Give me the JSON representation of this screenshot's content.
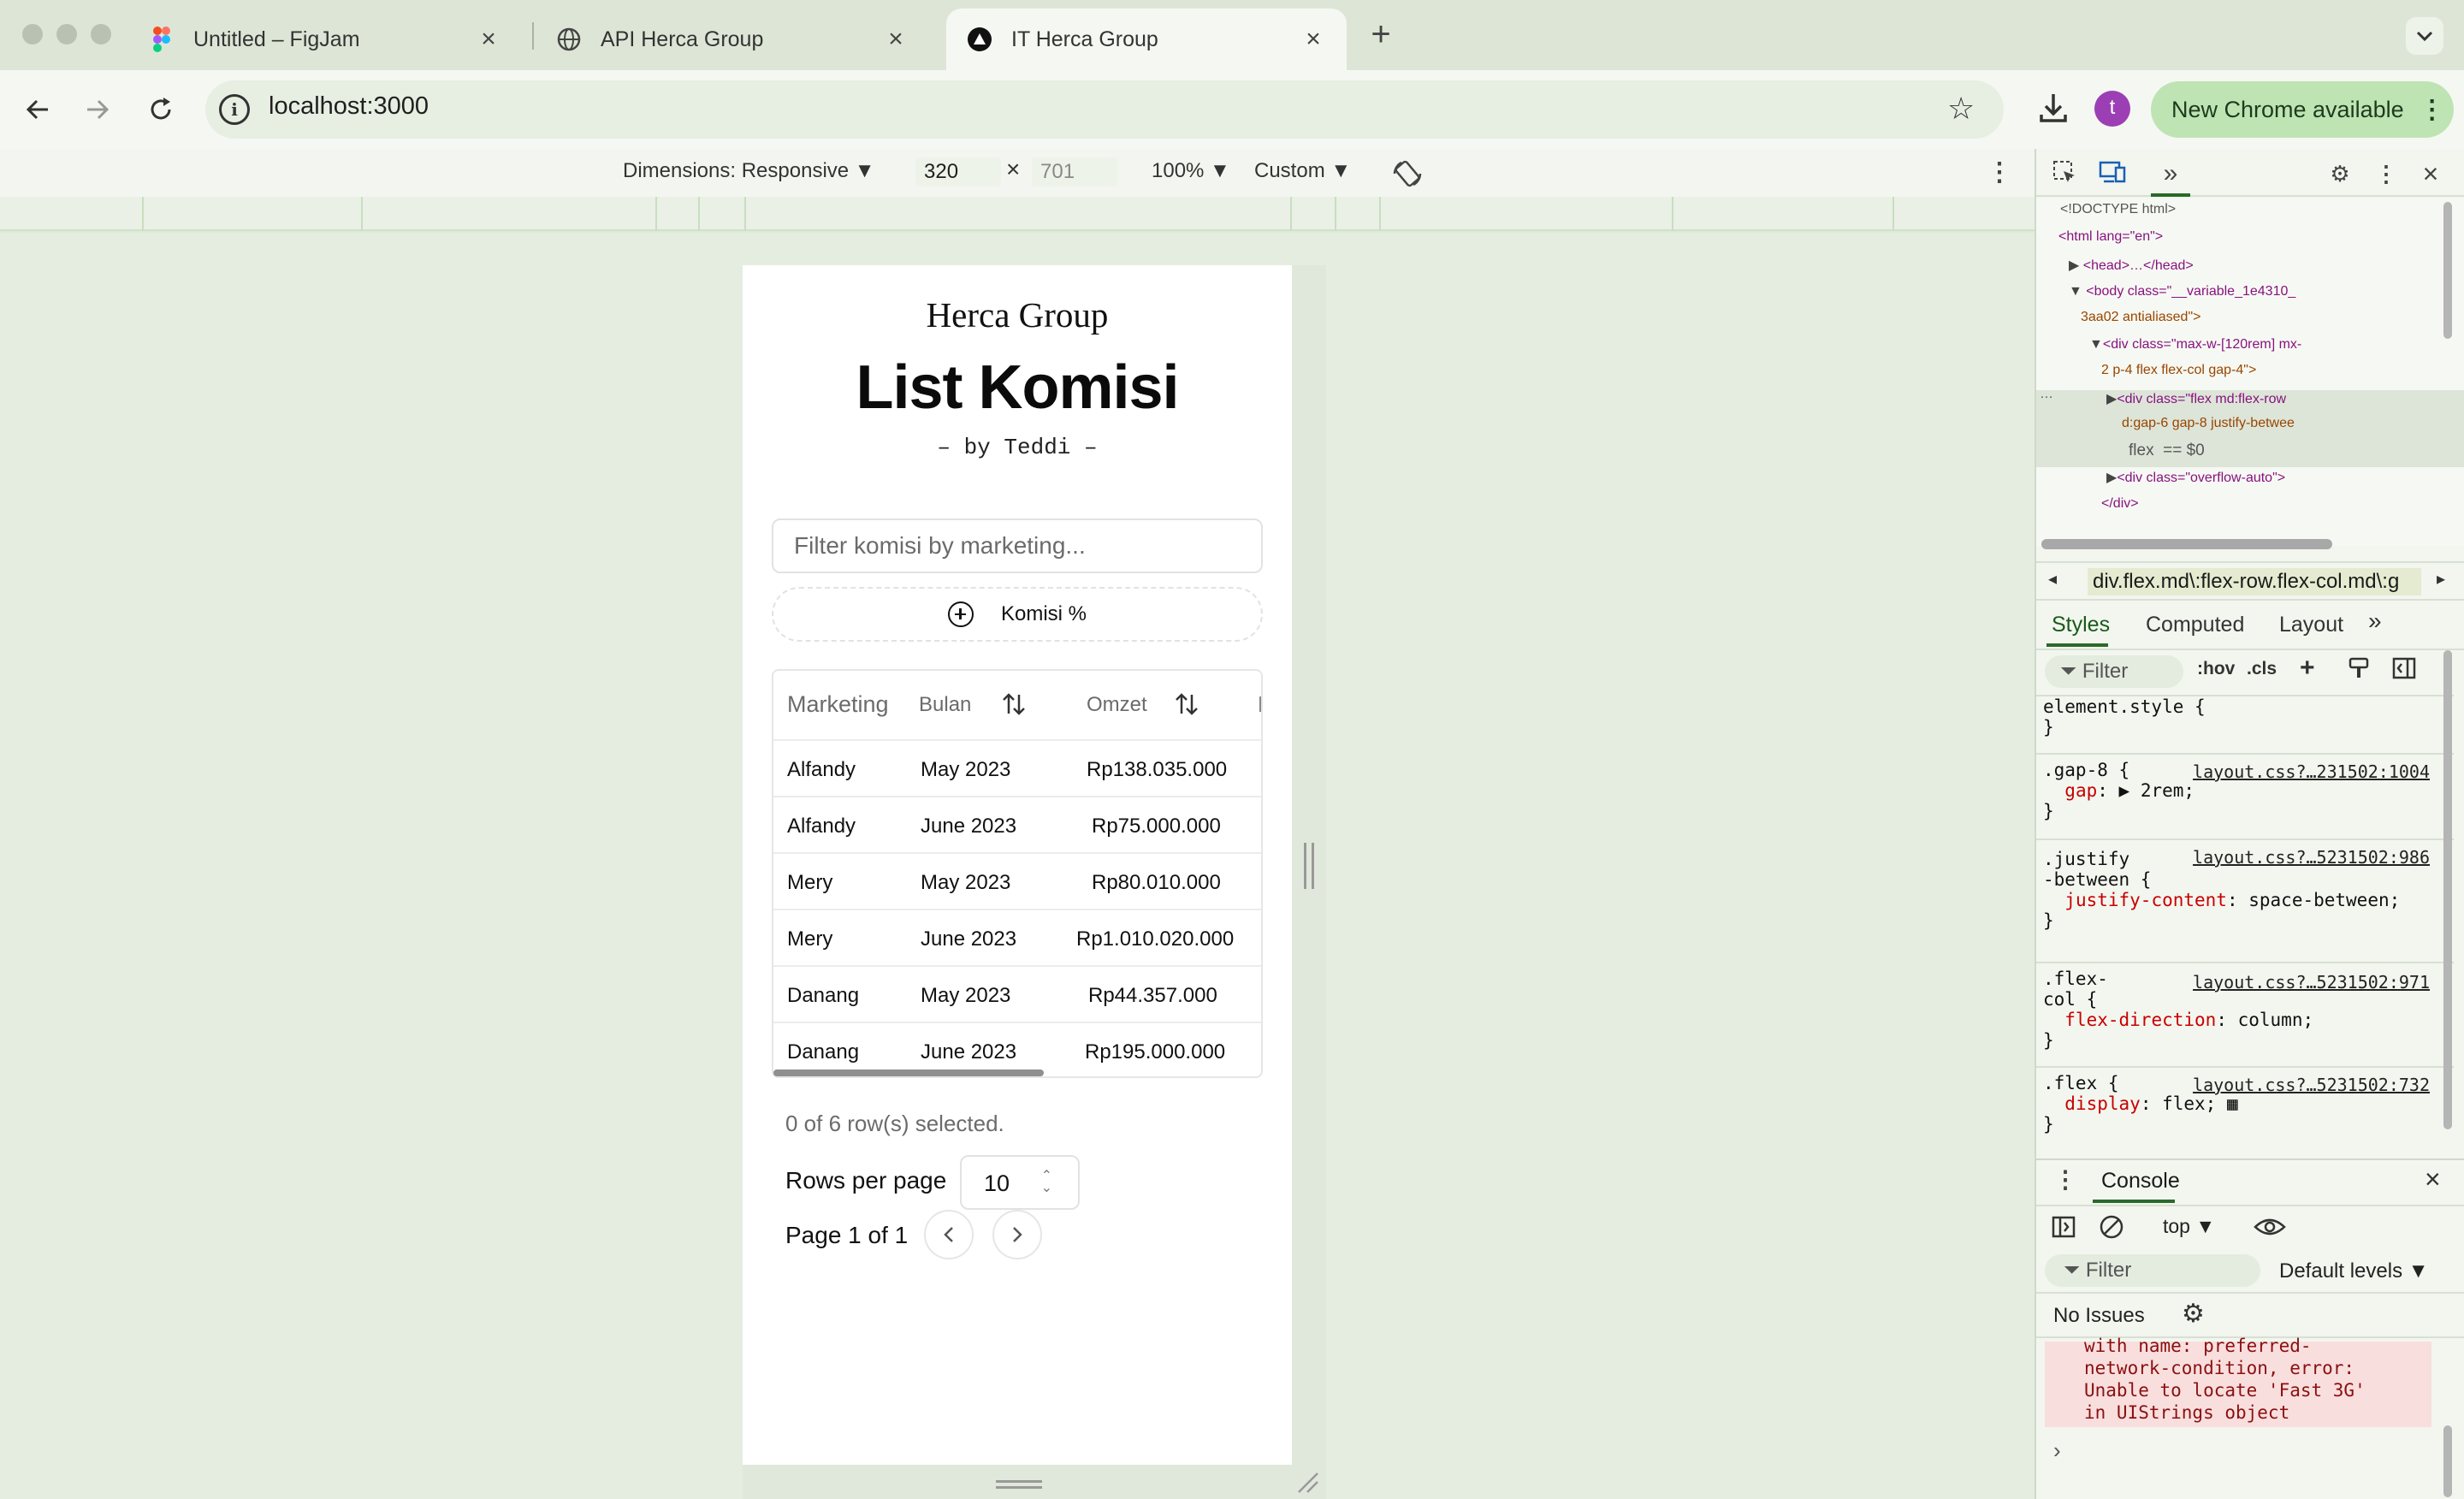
{
  "browser": {
    "tabs": [
      {
        "title": "Untitled – FigJam",
        "icon": "figma-icon"
      },
      {
        "title": "API Herca Group",
        "icon": "globe-icon"
      },
      {
        "title": "IT Herca Group",
        "icon": "vercel-triangle-icon"
      }
    ],
    "url": "localhost:3000",
    "profile_initial": "t",
    "new_chrome_label": "New Chrome available"
  },
  "device_toolbar": {
    "dimensions_label": "Dimensions: Responsive ▼",
    "width": "320",
    "times": "×",
    "height": "701",
    "zoom": "100% ▼",
    "throttle": "Custom ▼"
  },
  "page": {
    "brand": "Herca Group",
    "title": "List Komisi",
    "subtitle": "– by Teddi –",
    "filter_placeholder": "Filter komisi by marketing...",
    "komisi_button": "Komisi %",
    "table": {
      "headers": [
        "Marketing",
        "Bulan",
        "Omzet"
      ],
      "rows": [
        {
          "marketing": "Alfandy",
          "bulan": "May 2023",
          "omzet": "Rp138.035.000"
        },
        {
          "marketing": "Alfandy",
          "bulan": "June 2023",
          "omzet": "Rp75.000.000"
        },
        {
          "marketing": "Mery",
          "bulan": "May 2023",
          "omzet": "Rp80.010.000"
        },
        {
          "marketing": "Mery",
          "bulan": "June 2023",
          "omzet": "Rp1.010.020.000"
        },
        {
          "marketing": "Danang",
          "bulan": "May 2023",
          "omzet": "Rp44.357.000"
        },
        {
          "marketing": "Danang",
          "bulan": "June 2023",
          "omzet": "Rp195.000.000"
        }
      ]
    },
    "selection_text": "0 of 6 row(s) selected.",
    "rows_per_page_label": "Rows per page",
    "rows_per_page_value": "10",
    "page_label": "Page 1 of 1"
  },
  "devtools": {
    "elements_lines": [
      "<!DOCTYPE html>",
      "<html lang=\"en\">",
      "<head>…</head>",
      "<body class=\"__variable_1e4310_",
      "3aa02 antialiased\">",
      "<div class=\"max-w-[120rem] mx-",
      "2 p-4 flex flex-col gap-4\">",
      "<div class=\"flex md:flex-row",
      "d:gap-6 gap-8 justify-betwee",
      "flex  == $0",
      "<div class=\"overflow-auto\">",
      "</div>"
    ],
    "breadcrumb": "div.flex.md\\:flex-row.flex-col.md\\:g",
    "style_tabs": [
      "Styles",
      "Computed",
      "Layout"
    ],
    "style_filter": "Filter",
    "hov": ":hov",
    "cls": ".cls",
    "rules": [
      {
        "selector": "element.style {",
        "body": "}",
        "source": ""
      },
      {
        "selector": ".gap-8 {",
        "prop": "gap",
        "value": "▶ 2rem;",
        "source": "layout.css?…231502:1004"
      },
      {
        "selector": ".justify\n-between {",
        "prop": "justify-content",
        "value": "space-between;",
        "source": "layout.css?…5231502:986"
      },
      {
        "selector": ".flex-\ncol {",
        "prop": "flex-direction",
        "value": "column;",
        "source": "layout.css?…5231502:971"
      },
      {
        "selector": ".flex {",
        "prop": "display",
        "value": "flex;",
        "source": "layout.css?…5231502:732"
      }
    ],
    "console": {
      "title": "Console",
      "context": "top ▼",
      "filter": "Filter",
      "levels": "Default levels ▼",
      "issues": "No Issues",
      "error": "with name: preferred-\nnetwork-condition, error:\nUnable to locate 'Fast 3G'\nin UIStrings object"
    }
  }
}
